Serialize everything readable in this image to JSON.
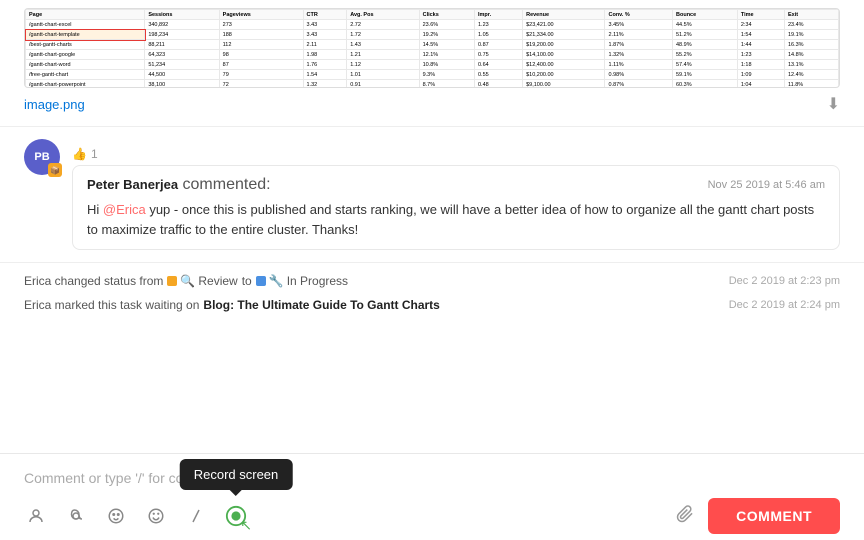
{
  "image": {
    "filename": "image.png",
    "download_tooltip": "Download"
  },
  "comment": {
    "author_initials": "PB",
    "author_badge": "📦",
    "author_name": "Peter Banerjea",
    "action": "commented:",
    "timestamp": "Nov 25 2019 at 5:46 am",
    "mention": "@Erica",
    "body_before": "Hi ",
    "body_after": " yup - once this is published and starts ranking, we will have a better idea of how to organize all the gantt chart posts to maximize traffic to the entire cluster. Thanks!",
    "like_count": "1"
  },
  "activities": [
    {
      "text_before": "Erica changed status from",
      "from_status": "Review",
      "to_label": "to",
      "to_status": "In Progress",
      "timestamp": "Dec 2 2019 at 2:23 pm"
    },
    {
      "text_before": "Erica marked this task waiting on",
      "link_text": "Blog: The Ultimate Guide To Gantt Charts",
      "timestamp": "Dec 2 2019 at 2:24 pm"
    }
  ],
  "comment_input": {
    "placeholder": "Comment or type '/' for commands"
  },
  "toolbar": {
    "tooltip_record": "Record screen",
    "comment_button_label": "COMMENT",
    "icons": {
      "mention": "@",
      "emoji": "😊",
      "attach": "📎",
      "at": "@",
      "slash": "/",
      "screen_record": "⏺"
    }
  }
}
